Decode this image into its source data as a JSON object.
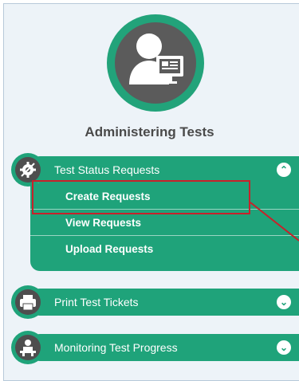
{
  "section": {
    "title": "Administering Tests"
  },
  "menus": [
    {
      "label": "Test Status Requests",
      "expanded": true,
      "icon": "gear-icon",
      "items": [
        {
          "label": "Create Requests"
        },
        {
          "label": "View Requests"
        },
        {
          "label": "Upload Requests"
        }
      ]
    },
    {
      "label": "Print Test Tickets",
      "expanded": false,
      "icon": "printer-icon"
    },
    {
      "label": "Monitoring Test Progress",
      "expanded": false,
      "icon": "monitoring-icon"
    }
  ],
  "colors": {
    "accent": "#1fa37a",
    "highlight": "#c8212a",
    "dark_icon": "#4e4e4e",
    "panel": "#edf3f8"
  }
}
